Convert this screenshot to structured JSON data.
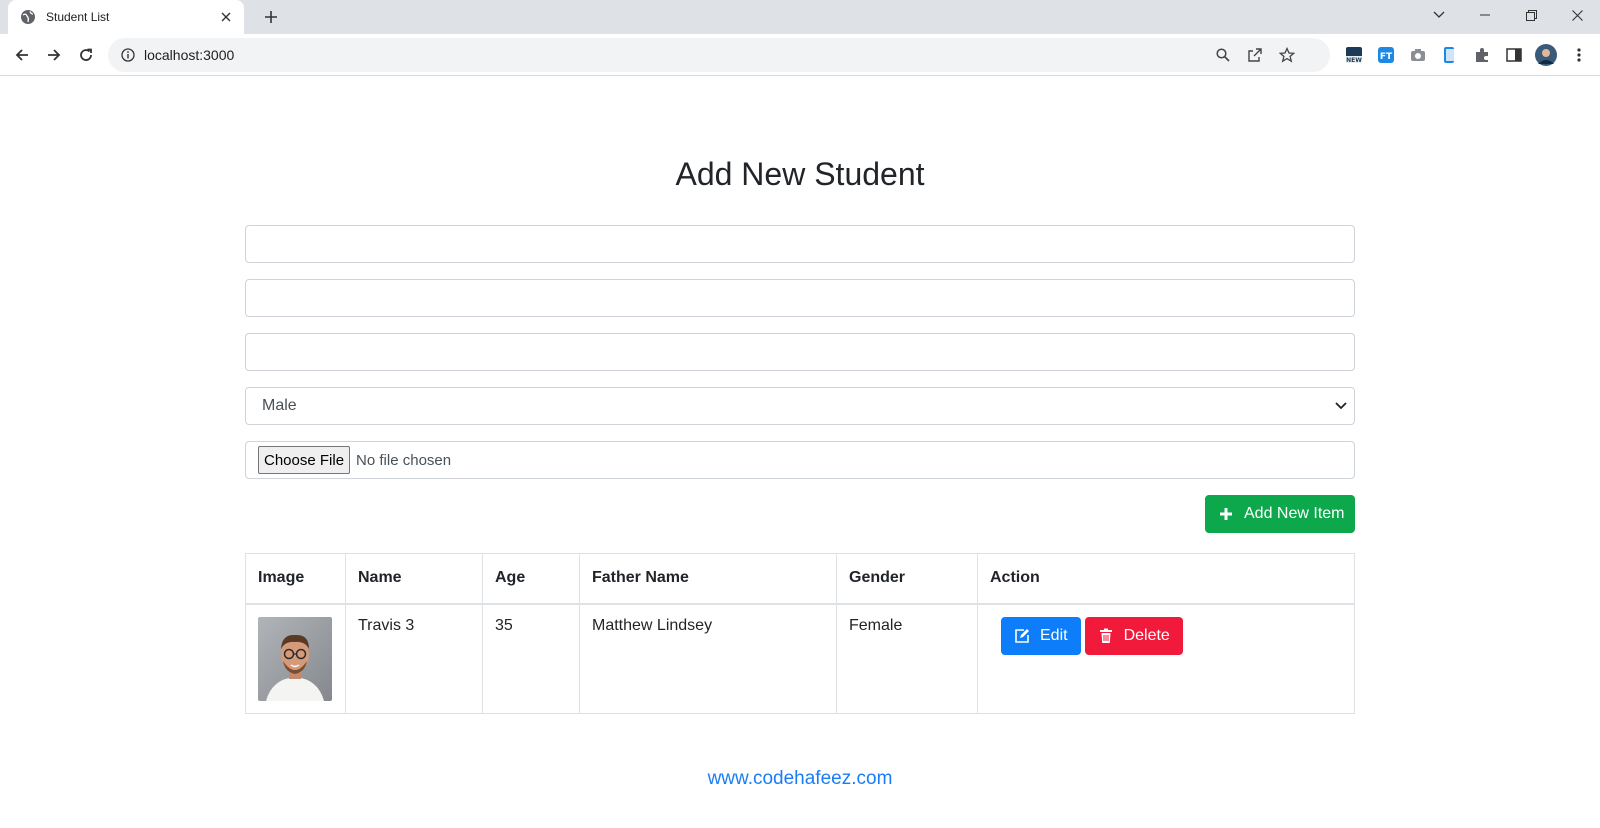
{
  "browser": {
    "tab_title": "Student List",
    "url": "localhost:3000"
  },
  "page": {
    "title": "Add New Student",
    "form": {
      "name_value": "",
      "age_value": "",
      "father_value": "",
      "gender_selected": "Male",
      "file_button": "Choose File",
      "file_status": "No file chosen",
      "submit_label": "Add New Item"
    },
    "table": {
      "headers": [
        "Image",
        "Name",
        "Age",
        "Father Name",
        "Gender",
        "Action"
      ],
      "rows": [
        {
          "name": "Travis 3",
          "age": "35",
          "father": "Matthew Lindsey",
          "gender": "Female",
          "edit_label": "Edit",
          "delete_label": "Delete"
        }
      ]
    },
    "footer_link": "www.codehafeez.com"
  },
  "colors": {
    "success": "#0ca84b",
    "primary": "#0d7dfa",
    "danger": "#f11a3b",
    "link": "#1a7df5"
  }
}
